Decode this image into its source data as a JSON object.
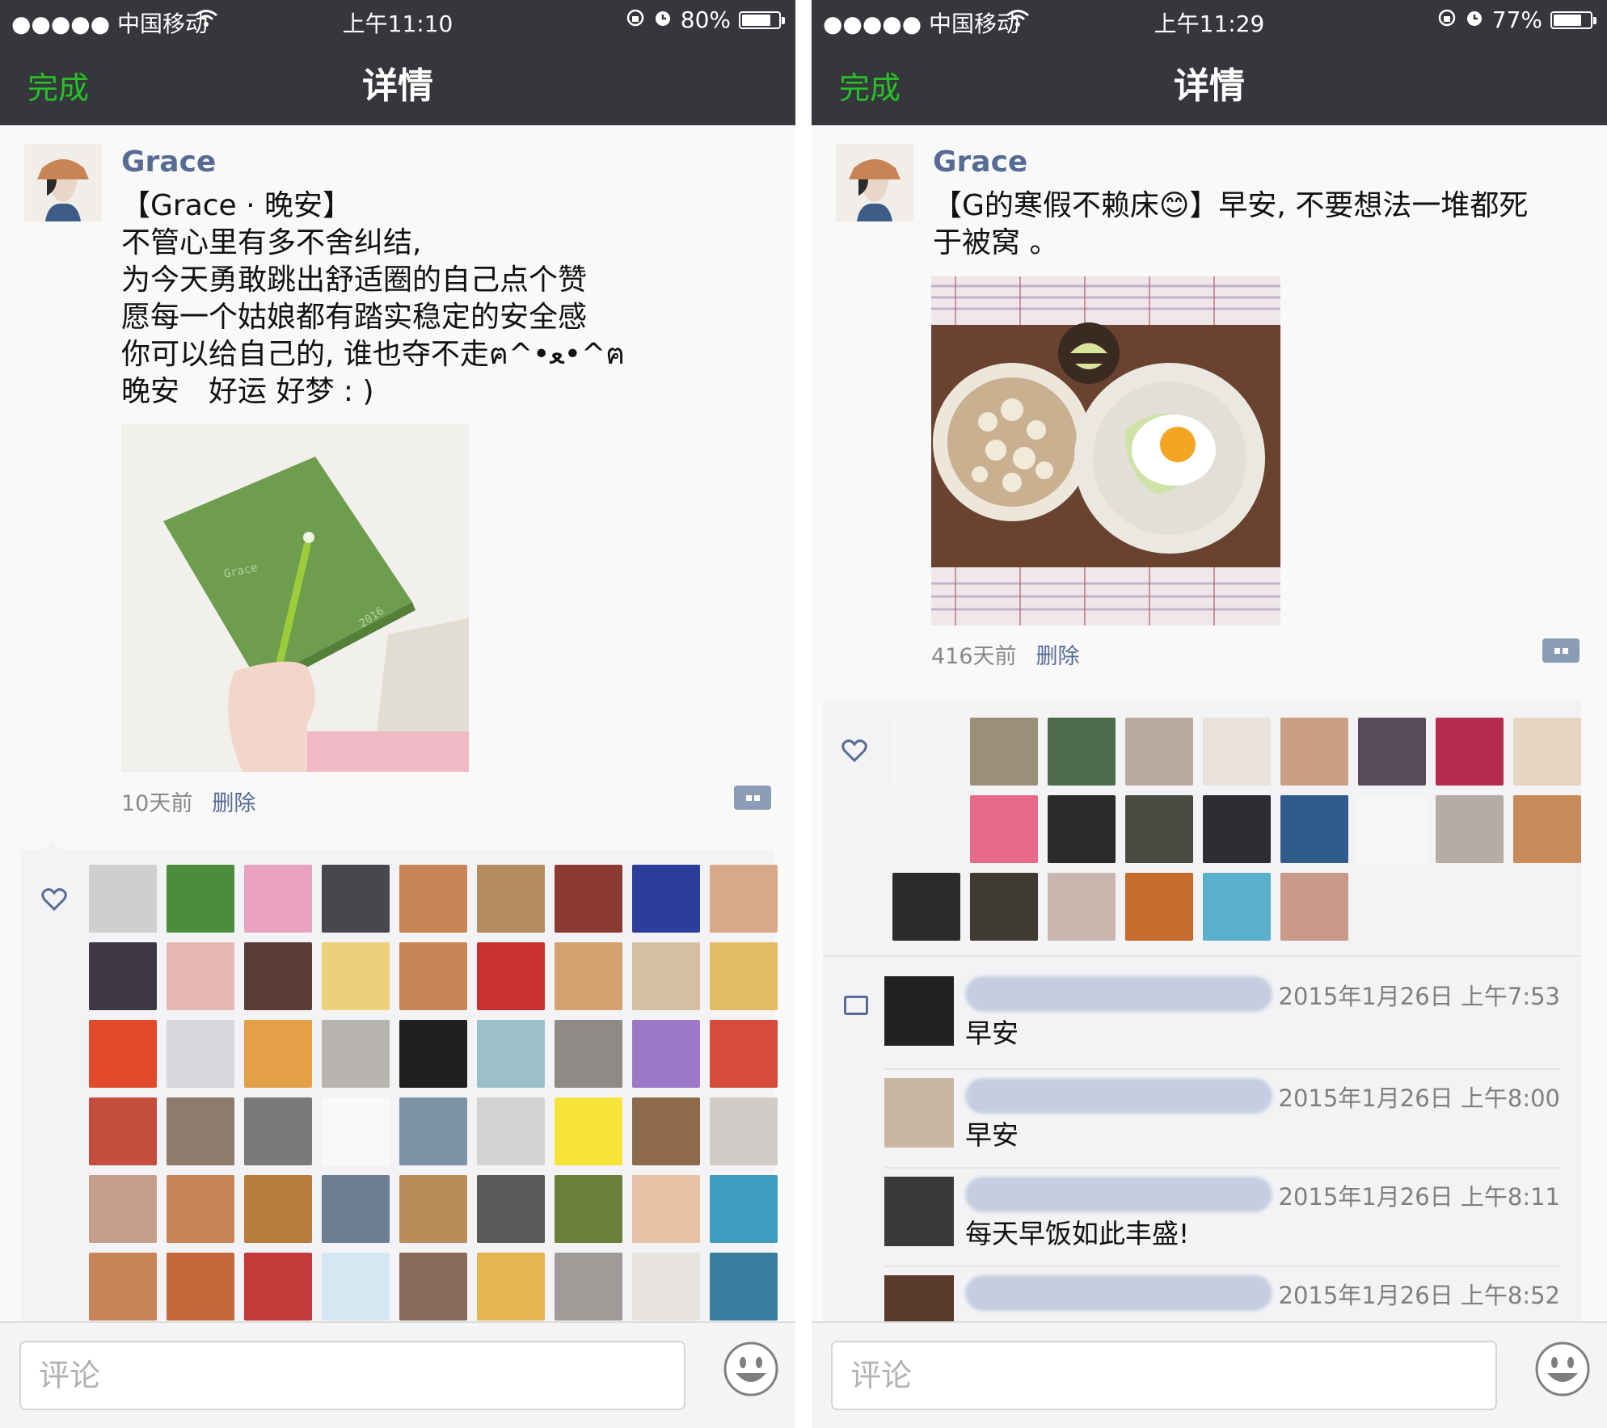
{
  "screens": [
    {
      "status": {
        "carrier": "●●●●● 中国移动",
        "time": "上午11:10",
        "battery": "80%",
        "battery_level": 0.8
      },
      "nav": {
        "done": "完成",
        "title": "详情"
      },
      "post": {
        "author": "Grace",
        "text": "【Grace · 晚安】\n不管心里有多不舍纠结,\n为今天勇敢跳出舒适圈的自己点个赞\n愿每一个姑娘都有踏实稳定的安全感\n你可以给自己的, 谁也夺不走ฅ^•ﻌ•^ฅ\n晚安　好运 好梦 : )",
        "photo_caption": "Grace",
        "photo_year": "2016",
        "time_ago": "10天前",
        "delete": "删除"
      },
      "likes_colors": [
        "#cfcfcf",
        "#4c8d3d",
        "#e9a3be",
        "#46484c",
        "#c98455",
        "#b38d5e",
        "#8b3a32",
        "#2d3d9a",
        "#d9a78a",
        "#3d3843",
        "#e7b7b1",
        "#5a3c36",
        "#efd07a",
        "#c98455",
        "#c9302e",
        "#d6a170",
        "#d6bfa1",
        "#e3bb62",
        "#e14b2c",
        "#d9d6de",
        "#e3a047",
        "#b8b4b0",
        "#202020",
        "#9bc0ca",
        "#8f8a86",
        "#9b79c9",
        "#d74b3c",
        "#c44d3e",
        "#8d7b6c",
        "#7a7a7a",
        "#f9f9f9",
        "#7c93a7",
        "#d3d3d3",
        "#f7e43a",
        "#8c6a4a",
        "#d2ccc9",
        "#c4a08c",
        "#c98455",
        "#b77b3d",
        "#6e7f94",
        "#b88d5a",
        "#5a5a5a",
        "#6b7f3a",
        "#e7c0a6",
        "#3f9bbf",
        "#c98455",
        "#c4683a",
        "#c23a3a",
        "#d4e8f4",
        "#8a6a5a",
        "#e5b54f",
        "#a09a98",
        "#e7e4e0",
        "#3b7ea0"
      ],
      "comment_placeholder": "评论"
    },
    {
      "status": {
        "carrier": "●●●●● 中国移动",
        "time": "上午11:29",
        "battery": "77%",
        "battery_level": 0.77
      },
      "nav": {
        "done": "完成",
        "title": "详情"
      },
      "post": {
        "author": "Grace",
        "text": "【G的寒假不赖床😊】早安, 不要想法一堆都死\n于被窝 。",
        "time_ago": "416天前",
        "delete": "删除"
      },
      "likes_colors": [
        "#f5f5f5",
        "#9b8f7a",
        "#4d6b4a",
        "#b9a9a0",
        "#e9e2dc",
        "#c99e82",
        "#5a4b5a",
        "#b52b4d",
        "#e7d5c2",
        "#f4f4f4",
        "#e86a8a",
        "#2a2a2a",
        "#4a4a42",
        "#2c2e33",
        "#2f5c8a",
        "#f6f6f6",
        "#b5aca4",
        "#c98a5a",
        "#2b2b2b",
        "#3f3a32",
        "#c9b6ae",
        "#c66a2e",
        "#5ab0cc",
        "#c99a8a"
      ],
      "comments": [
        {
          "time": "2015年1月26日 上午7:53",
          "text": "早安",
          "avatar_color": "#222222"
        },
        {
          "time": "2015年1月26日 上午8:00",
          "text": "早安",
          "avatar_color": "#c9b7a3"
        },
        {
          "time": "2015年1月26日 上午8:11",
          "text": "每天早饭如此丰盛!",
          "avatar_color": "#3a3a3a"
        },
        {
          "time": "2015年1月26日 上午8:52",
          "text": "",
          "avatar_color": "#5a3a2a"
        }
      ],
      "comment_placeholder": "评论"
    }
  ]
}
